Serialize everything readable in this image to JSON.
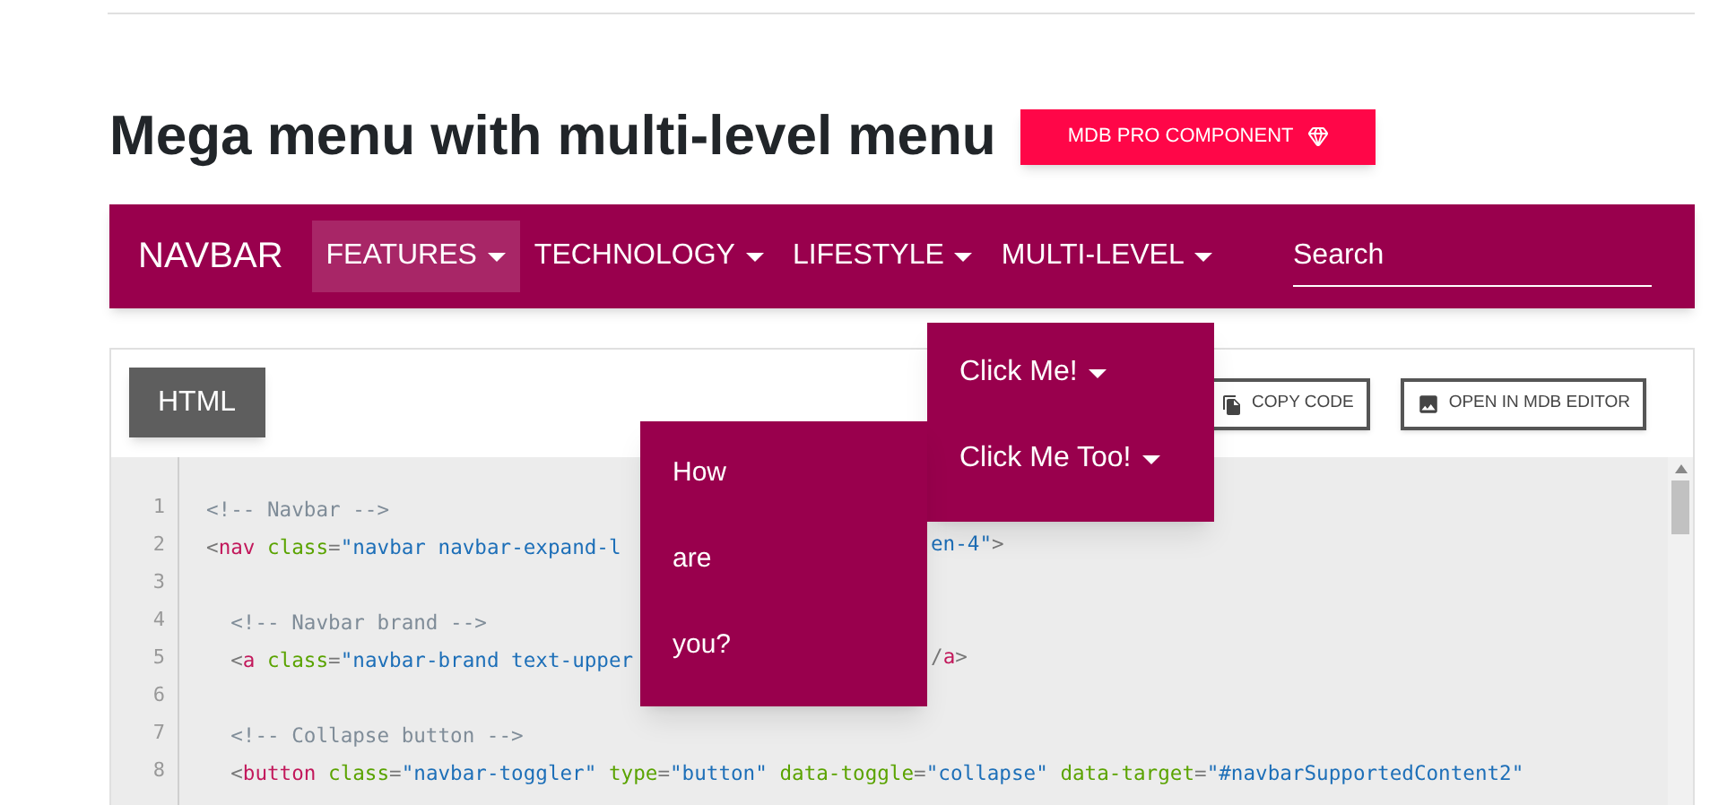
{
  "title": "Mega menu with multi-level menu",
  "badge": {
    "label": "MDB PRO COMPONENT"
  },
  "navbar": {
    "brand": "NAVBAR",
    "items": [
      {
        "label": "FEATURES",
        "selected": true
      },
      {
        "label": "TECHNOLOGY",
        "selected": false
      },
      {
        "label": "LIFESTYLE",
        "selected": false
      },
      {
        "label": "MULTI-LEVEL",
        "selected": false
      }
    ],
    "search": {
      "placeholder": "Search"
    }
  },
  "dropdown": {
    "items": [
      {
        "label": "Click Me!"
      },
      {
        "label": "Click Me Too!"
      }
    ]
  },
  "submenu": {
    "items": [
      "How",
      "are",
      "you?"
    ]
  },
  "code_panel": {
    "tabs": [
      {
        "label": "HTML",
        "selected": true
      }
    ],
    "buttons": [
      {
        "label": "COPY CODE",
        "kind": "copy"
      },
      {
        "label": "OPEN IN MDB EDITOR",
        "kind": "image"
      }
    ],
    "lines": [
      {
        "number": "1",
        "left": [
          {
            "kind": "comment",
            "t": "<!-- Navbar -->"
          }
        ]
      },
      {
        "number": "2",
        "left": [
          {
            "kind": "punct",
            "t": "<"
          },
          {
            "kind": "tag",
            "t": "nav "
          },
          {
            "kind": "attr",
            "t": "class"
          },
          {
            "kind": "punct",
            "t": "="
          },
          {
            "kind": "string",
            "t": "\"navbar navbar-expand-l"
          }
        ],
        "right": [
          {
            "kind": "string",
            "t": "en-4\""
          },
          {
            "kind": "punct",
            "t": ">"
          }
        ]
      },
      {
        "number": "3"
      },
      {
        "number": "4",
        "left": [
          {
            "kind": "comment",
            "t": "  <!-- Navbar brand -->"
          }
        ]
      },
      {
        "number": "5",
        "left": [
          {
            "kind": "punct",
            "t": "  <"
          },
          {
            "kind": "tag",
            "t": "a "
          },
          {
            "kind": "attr",
            "t": "class"
          },
          {
            "kind": "punct",
            "t": "="
          },
          {
            "kind": "string",
            "t": "\"navbar-brand text-upper"
          }
        ],
        "right": [
          {
            "kind": "punct",
            "t": "/"
          },
          {
            "kind": "tag",
            "t": "a"
          },
          {
            "kind": "punct",
            "t": ">"
          }
        ]
      },
      {
        "number": "6"
      },
      {
        "number": "7",
        "left": [
          {
            "kind": "comment",
            "t": "  <!-- Collapse button -->"
          }
        ]
      },
      {
        "number": "8",
        "left": [
          {
            "kind": "punct",
            "t": "  <"
          },
          {
            "kind": "tag",
            "t": "button "
          },
          {
            "kind": "attr",
            "t": "class"
          },
          {
            "kind": "punct",
            "t": "="
          },
          {
            "kind": "string",
            "t": "\"navbar-toggler\" "
          },
          {
            "kind": "attr",
            "t": "type"
          },
          {
            "kind": "punct",
            "t": "="
          },
          {
            "kind": "string",
            "t": "\"button\" "
          },
          {
            "kind": "attr",
            "t": "data-toggle"
          },
          {
            "kind": "punct",
            "t": "="
          },
          {
            "kind": "string",
            "t": "\"collapse\" "
          },
          {
            "kind": "attr",
            "t": "data-target"
          },
          {
            "kind": "punct",
            "t": "="
          },
          {
            "kind": "string",
            "t": "\"#navbarSupportedContent2\""
          }
        ]
      }
    ]
  }
}
